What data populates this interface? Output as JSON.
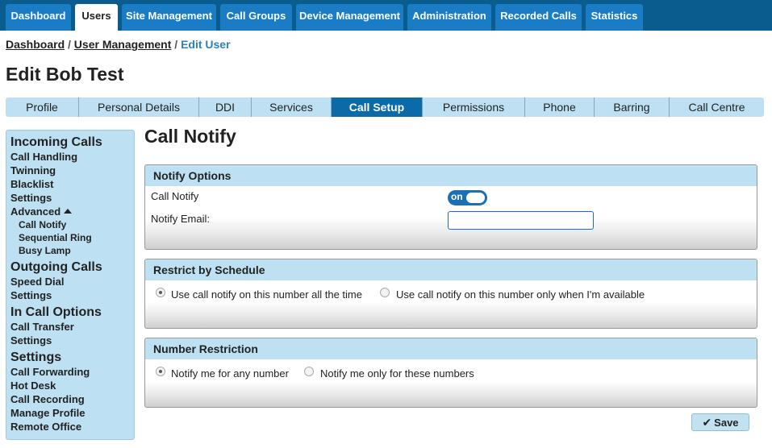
{
  "nav": {
    "tabs": [
      {
        "label": "Dashboard"
      },
      {
        "label": "Users"
      },
      {
        "label": "Site Management"
      },
      {
        "label": "Call Groups"
      },
      {
        "label": "Device Management"
      },
      {
        "label": "Administration"
      },
      {
        "label": "Recorded Calls"
      },
      {
        "label": "Statistics"
      }
    ],
    "active": "Users"
  },
  "breadcrumb": {
    "items": [
      "Dashboard",
      "User Management",
      "Edit User"
    ],
    "separator": "/"
  },
  "page_title": "Edit Bob Test",
  "subtabs": {
    "items": [
      "Profile",
      "Personal Details",
      "DDI",
      "Services",
      "Call Setup",
      "Permissions",
      "Phone",
      "Barring",
      "Call Centre"
    ],
    "active": "Call Setup"
  },
  "sidebar": {
    "incoming": {
      "heading": "Incoming Calls",
      "items": [
        "Call Handling",
        "Twinning",
        "Blacklist",
        "Settings"
      ],
      "advanced": "Advanced",
      "advanced_items": [
        "Call Notify",
        "Sequential Ring",
        "Busy Lamp"
      ]
    },
    "outgoing": {
      "heading": "Outgoing Calls",
      "items": [
        "Speed Dial",
        "Settings"
      ]
    },
    "in_call": {
      "heading": "In Call Options",
      "items": [
        "Call Transfer",
        "Settings"
      ]
    },
    "settings": {
      "heading": "Settings",
      "items": [
        "Call Forwarding",
        "Hot Desk",
        "Call Recording",
        "Manage Profile",
        "Remote Office"
      ]
    }
  },
  "content": {
    "title": "Call Notify",
    "notify_options": {
      "heading": "Notify Options",
      "call_notify_label": "Call Notify",
      "toggle_text": "on",
      "toggle_state": true,
      "email_label": "Notify Email:",
      "email_value": ""
    },
    "schedule": {
      "heading": "Restrict by Schedule",
      "options": [
        {
          "label": "Use call notify on this number all the time",
          "selected": true
        },
        {
          "label": "Use call notify on this number only when I'm available",
          "selected": false
        }
      ]
    },
    "number_restriction": {
      "heading": "Number Restriction",
      "options": [
        {
          "label": "Notify me for any number",
          "selected": true
        },
        {
          "label": "Notify me only for these numbers",
          "selected": false
        }
      ]
    },
    "save_label": "Save"
  },
  "colors": {
    "nav_bar": "#0b5c8e",
    "nav_tab": "#1a7cc4",
    "panel_header": "#bde1f3",
    "active_subtab": "#0b6aa8",
    "link_current": "#2a82c4"
  }
}
